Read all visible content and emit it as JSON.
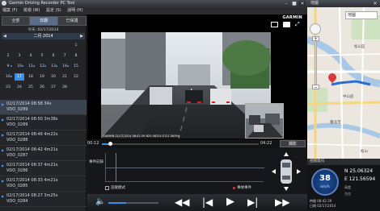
{
  "window": {
    "title": "Garmin Driving Recorder PC Tool",
    "map_title": "地圖",
    "minimize": "–",
    "restore": "■",
    "close": "✕"
  },
  "menu": [
    "檔案 (F)",
    "檢視 (W)",
    "設定 (S)",
    "說明 (H)"
  ],
  "left": {
    "tabs": [
      "全部",
      "日期",
      "已保護"
    ],
    "today_label": "今天: 02/17/2014",
    "month_label": "二月 2014",
    "calendar_rows": [
      [
        "",
        "",
        "",
        "",
        "",
        "",
        "1"
      ],
      [
        "2",
        "3",
        "4",
        "5",
        "6",
        "7",
        "8"
      ],
      [
        "9",
        "10",
        "11",
        "12",
        "13",
        "14",
        "15"
      ],
      [
        "16",
        "17",
        "18",
        "19",
        "20",
        "21",
        "22"
      ],
      [
        "23",
        "24",
        "25",
        "26",
        "27",
        "28",
        ""
      ]
    ],
    "clips": [
      {
        "time": "02/17/2014 08:58 34s",
        "name": "VDO_0289"
      },
      {
        "time": "02/17/2014 08:50 3m38s",
        "name": "VDO_0289"
      },
      {
        "time": "02/17/2014 08:46 4m22s",
        "name": "VDO_0288"
      },
      {
        "time": "02/17/2014 08:42 4m21s",
        "name": "VDO_0287"
      },
      {
        "time": "02/17/2014 08:37 4m21s",
        "name": "VDO_0286"
      },
      {
        "time": "02/17/2014 08:33 4m21s",
        "name": "VDO_0285"
      },
      {
        "time": "02/17/2014 08:27 3m25s",
        "name": "VDO_0284"
      }
    ]
  },
  "video": {
    "brand": "GARMIN",
    "timestamp_overlay": "GARMIN 02/17/2014 08:42:39 N25.06324 E121.56594",
    "elapsed": "00:12",
    "duration": "04:22",
    "snapshot_label": "擷影",
    "progress_fraction": 0.05
  },
  "graph": {
    "event_label": "事件記錄",
    "gsensor_label": "追蹤模式",
    "event_marker_label": "事故事件"
  },
  "controls": {
    "volume_fraction": 0.35
  },
  "map": {
    "search_placeholder": "地圖",
    "place1": "松山區",
    "place2": "臺北市",
    "place3": "中山區",
    "place4": "松山",
    "zoom_in": "+",
    "zoom_out": "−"
  },
  "gps": {
    "header": "相關資訊",
    "speed": "38",
    "speed_unit": "km/h",
    "lat": "N 25.06324",
    "lon": "E 121.56594",
    "altitude_label": "高度",
    "heading_label": "方位",
    "date_label": "時間 08:42:39",
    "date_value": "日期 02/17/2014"
  },
  "colors": {
    "accent": "#3a8fe0",
    "route": "#2e6cd6",
    "pin": "#d93a3a"
  }
}
